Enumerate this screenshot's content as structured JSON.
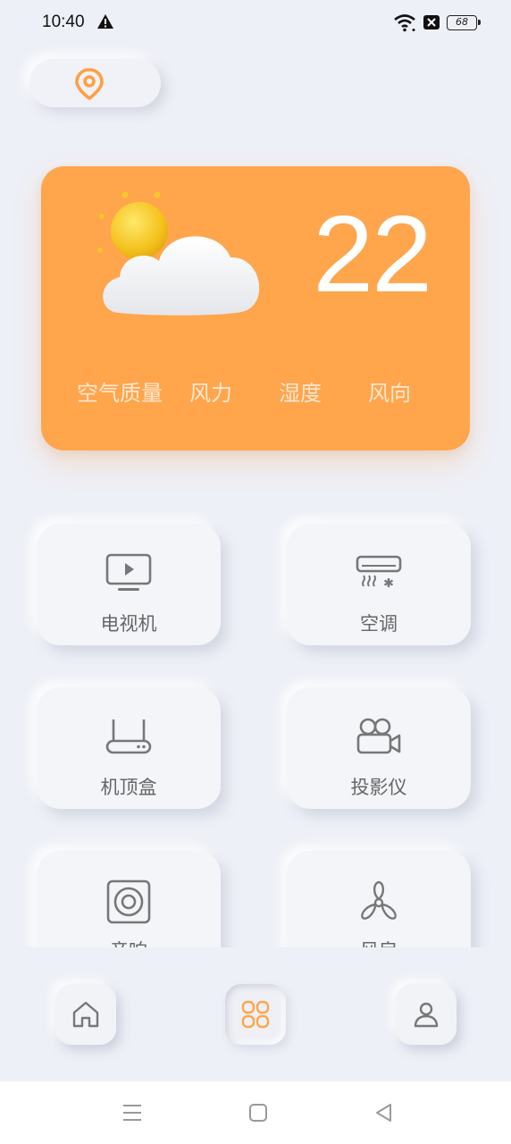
{
  "status_bar": {
    "time": "10:40",
    "battery": "68",
    "icons": [
      "warning-icon",
      "wifi-icon",
      "no-sim-icon",
      "battery-icon"
    ]
  },
  "location": {
    "icon": "location-pin-icon",
    "color": "#ff9f43"
  },
  "weather": {
    "temperature": "22",
    "icon": "partly-sunny-icon",
    "card_color": "#ffa54c",
    "metrics": [
      "空气质量",
      "风力",
      "湿度",
      "风向"
    ]
  },
  "devices": [
    {
      "label": "电视机",
      "icon": "tv-icon"
    },
    {
      "label": "空调",
      "icon": "air-conditioner-icon"
    },
    {
      "label": "机顶盒",
      "icon": "set-top-box-icon"
    },
    {
      "label": "投影仪",
      "icon": "projector-icon"
    },
    {
      "label": "音响",
      "icon": "speaker-icon"
    },
    {
      "label": "风扇",
      "icon": "fan-icon"
    }
  ],
  "bottom_nav": {
    "items": [
      "home-icon",
      "apps-icon",
      "profile-icon"
    ],
    "active": "apps-icon",
    "active_color": "#ffa54c"
  },
  "system_nav": [
    "menu-icon",
    "home-square-icon",
    "back-icon"
  ]
}
